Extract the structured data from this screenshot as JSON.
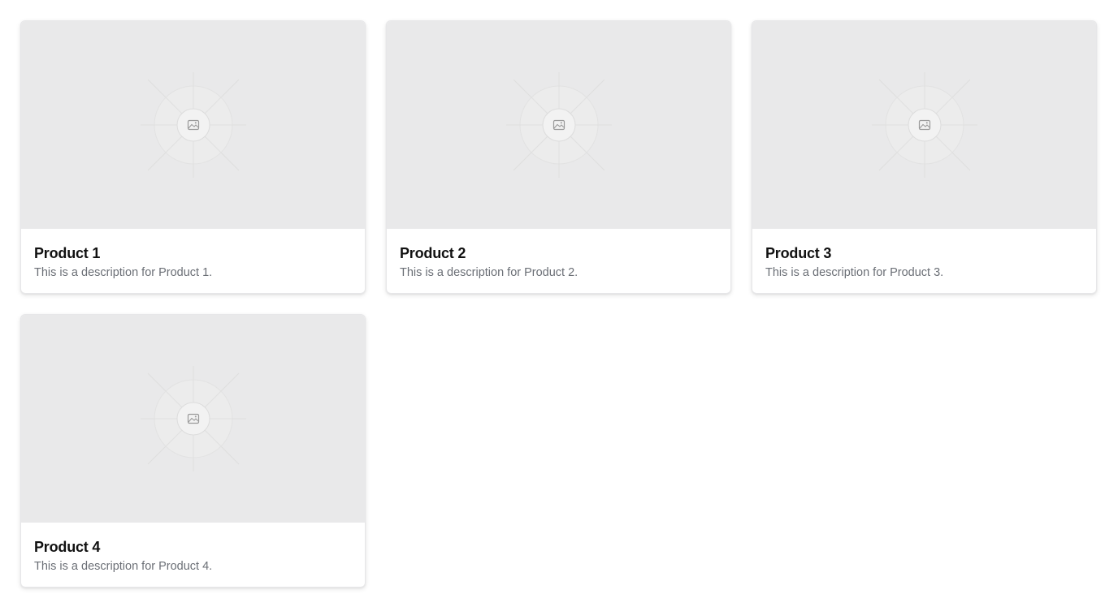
{
  "products": [
    {
      "title": "Product 1",
      "description": "This is a description for Product 1.",
      "image_icon": "image-placeholder-icon"
    },
    {
      "title": "Product 2",
      "description": "This is a description for Product 2.",
      "image_icon": "image-placeholder-icon"
    },
    {
      "title": "Product 3",
      "description": "This is a description for Product 3.",
      "image_icon": "image-placeholder-icon"
    },
    {
      "title": "Product 4",
      "description": "This is a description for Product 4.",
      "image_icon": "image-placeholder-icon"
    }
  ],
  "colors": {
    "image_bg": "#e9e9ea",
    "title": "#111111",
    "description": "#6b6f76",
    "card_border": "#e7e7e9"
  }
}
